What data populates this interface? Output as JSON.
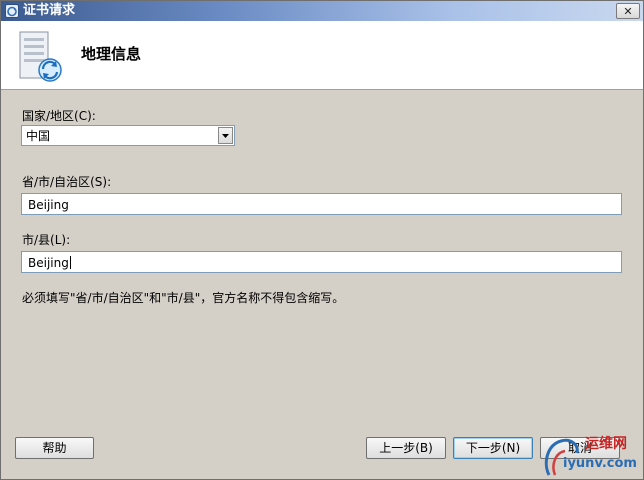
{
  "window": {
    "title": "证书请求",
    "close_glyph": "✕"
  },
  "header": {
    "title": "地理信息",
    "icon": "certificate-server-icon"
  },
  "form": {
    "country_label": "国家/地区(C):",
    "country_value": "中国",
    "province_label": "省/市/自治区(S):",
    "province_value": "Beijing",
    "city_label": "市/县(L):",
    "city_value": "Beijing",
    "note": "必须填写\"省/市/自治区\"和\"市/县\"，官方名称不得包含缩写。"
  },
  "buttons": {
    "help": "帮助",
    "back": "上一步(B)",
    "next": "下一步(N)",
    "cancel": "取消"
  },
  "watermark": {
    "text_cn": "运维网",
    "text_url": "iyunv.com"
  },
  "colors": {
    "title_bar": "#3b5a8f",
    "dialog_bg": "#d4d0c8",
    "header_bg": "#ffffff",
    "input_border": "#7f9db9"
  }
}
